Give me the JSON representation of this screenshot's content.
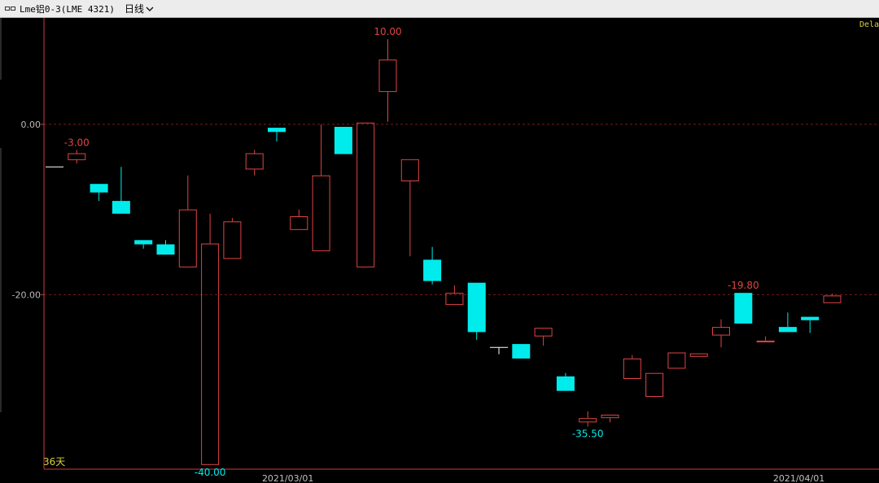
{
  "header": {
    "title": "Lme铝0-3(LME 4321)",
    "title_icon": "window-icon",
    "period": "日线",
    "dropdown_icon": "chevron-down-icon"
  },
  "status": {
    "delay": "Dela",
    "days_label": "36天"
  },
  "colors": {
    "up": "#e04444",
    "down": "#00ecec",
    "flat": "#ffffff",
    "grid": "#7a1a1a",
    "axis": "#d43a3a",
    "top_bar": "#ececec"
  },
  "chart_data": {
    "type": "candlestick",
    "ylim": [
      -40.5,
      12.5
    ],
    "yticks": [
      0,
      -20
    ],
    "ytick_labels": [
      "0.00",
      "-20.00"
    ],
    "x_labels": [
      {
        "index": 10.5,
        "label": "2021/03/01"
      },
      {
        "index": 33.5,
        "label": "2021/04/01"
      }
    ],
    "candles": [
      {
        "open": -5.0,
        "close": -5.0,
        "high": -5.0,
        "low": -5.0
      },
      {
        "open": -4.2,
        "close": -3.4,
        "high": -3.0,
        "low": -4.6
      },
      {
        "open": -7.0,
        "close": -8.0,
        "high": -7.0,
        "low": -9.0
      },
      {
        "open": -9.0,
        "close": -10.5,
        "high": -5.0,
        "low": -10.5
      },
      {
        "open": -13.6,
        "close": -14.1,
        "high": -13.6,
        "low": -14.6
      },
      {
        "open": -14.1,
        "close": -15.3,
        "high": -13.6,
        "low": -15.3
      },
      {
        "open": -16.8,
        "close": -10.0,
        "high": -6.0,
        "low": -16.8
      },
      {
        "open": -40.0,
        "close": -14.0,
        "high": -10.5,
        "low": -40.0
      },
      {
        "open": -15.8,
        "close": -11.4,
        "high": -11.0,
        "low": -15.8
      },
      {
        "open": -5.3,
        "close": -3.4,
        "high": -3.0,
        "low": -6.0
      },
      {
        "open": -0.4,
        "close": -0.9,
        "high": -0.4,
        "low": -2.0
      },
      {
        "open": -12.4,
        "close": -10.8,
        "high": -10.0,
        "low": -12.4
      },
      {
        "open": -14.9,
        "close": -6.0,
        "high": 0.0,
        "low": -14.9
      },
      {
        "open": -0.3,
        "close": -3.5,
        "high": -0.3,
        "low": -3.5
      },
      {
        "open": -16.8,
        "close": 0.2,
        "high": 0.2,
        "low": -16.8
      },
      {
        "open": 3.8,
        "close": 7.6,
        "high": 10.0,
        "low": 0.3
      },
      {
        "open": -6.7,
        "close": -4.1,
        "high": -4.1,
        "low": -15.5
      },
      {
        "open": -15.9,
        "close": -18.4,
        "high": -14.4,
        "low": -18.8
      },
      {
        "open": -21.2,
        "close": -19.8,
        "high": -18.9,
        "low": -21.2
      },
      {
        "open": -18.6,
        "close": -24.4,
        "high": -18.6,
        "low": -25.3
      },
      {
        "open": -26.2,
        "close": -26.2,
        "high": -26.2,
        "low": -27.0
      },
      {
        "open": -25.8,
        "close": -27.5,
        "high": -25.8,
        "low": -27.5
      },
      {
        "open": -24.9,
        "close": -23.9,
        "high": -23.9,
        "low": -26.0
      },
      {
        "open": -29.6,
        "close": -31.3,
        "high": -29.2,
        "low": -31.3
      },
      {
        "open": -35.0,
        "close": -34.5,
        "high": -33.7,
        "low": -35.5
      },
      {
        "open": -34.5,
        "close": -34.1,
        "high": -34.1,
        "low": -35.0
      },
      {
        "open": -29.9,
        "close": -27.5,
        "high": -27.1,
        "low": -29.9
      },
      {
        "open": -32.0,
        "close": -29.2,
        "high": -29.2,
        "low": -32.0
      },
      {
        "open": -28.7,
        "close": -26.8,
        "high": -26.8,
        "low": -28.7
      },
      {
        "open": -27.3,
        "close": -26.9,
        "high": -26.9,
        "low": -27.3
      },
      {
        "open": -24.8,
        "close": -23.8,
        "high": -22.9,
        "low": -26.2
      },
      {
        "open": -19.8,
        "close": -23.4,
        "high": -19.8,
        "low": -23.4
      },
      {
        "open": -25.6,
        "close": -25.4,
        "high": -24.9,
        "low": -25.6
      },
      {
        "open": -23.8,
        "close": -24.4,
        "high": -22.1,
        "low": -24.4
      },
      {
        "open": -22.6,
        "close": -23.0,
        "high": -22.6,
        "low": -24.5
      },
      {
        "open": -21.0,
        "close": -20.1,
        "high": -19.9,
        "low": -21.0
      }
    ],
    "annotations": [
      {
        "index": 1,
        "value": -3.0,
        "text": "-3.00",
        "kind": "high"
      },
      {
        "index": 15,
        "value": 10.0,
        "text": "10.00",
        "kind": "high"
      },
      {
        "index": 7,
        "value": -40.0,
        "text": "-40.00",
        "kind": "low"
      },
      {
        "index": 24,
        "value": -35.5,
        "text": "-35.50",
        "kind": "low"
      },
      {
        "index": 31,
        "value": -19.8,
        "text": "-19.80",
        "kind": "high"
      }
    ]
  }
}
